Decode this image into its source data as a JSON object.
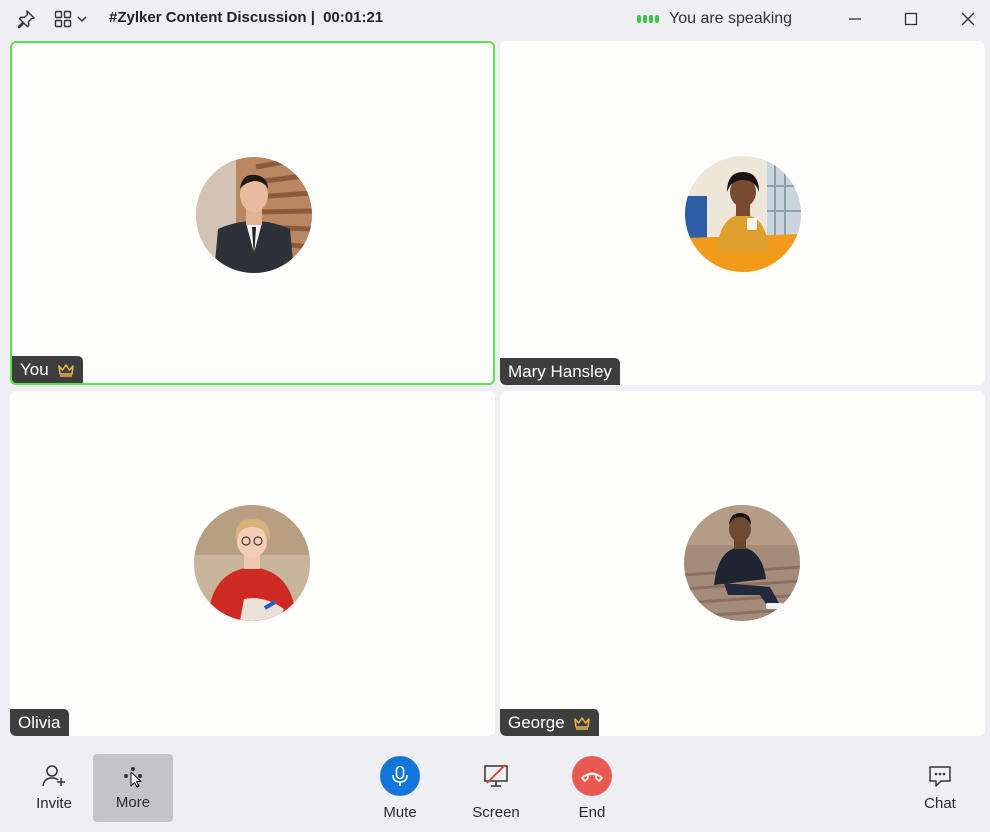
{
  "titlebar": {
    "title": "#Zylker Content Discussion |",
    "timer": "00:01:21",
    "speaking_status": "You are speaking",
    "speaking_color": "#3cc84a"
  },
  "participants": [
    {
      "name": "You",
      "host": true,
      "active": true,
      "avatar": "person-suit-photo"
    },
    {
      "name": "Mary Hansley",
      "host": false,
      "active": false,
      "avatar": "person-office-photo"
    },
    {
      "name": "Olivia",
      "host": false,
      "active": false,
      "avatar": "person-red-sweater-photo"
    },
    {
      "name": "George",
      "host": true,
      "active": false,
      "avatar": "person-steps-photo"
    }
  ],
  "toolbar": {
    "invite": "Invite",
    "more": "More",
    "mute": "Mute",
    "screen": "Screen",
    "end": "End",
    "chat": "Chat"
  },
  "colors": {
    "active_border": "#5ee04f",
    "mute_button": "#1475d9",
    "end_button": "#e85a4f",
    "crown": "#e9b949",
    "name_tag": "#3e3e3e"
  },
  "icons": {
    "pin": "pin-icon",
    "layout": "grid-layout-icon",
    "minimize": "minimize-icon",
    "maximize": "maximize-icon",
    "close": "close-icon",
    "crown": "crown-icon",
    "invite": "add-user-icon",
    "more": "more-dots-icon",
    "mute": "microphone-icon",
    "screen": "screen-share-off-icon",
    "end": "hang-up-icon",
    "chat": "chat-icon"
  }
}
